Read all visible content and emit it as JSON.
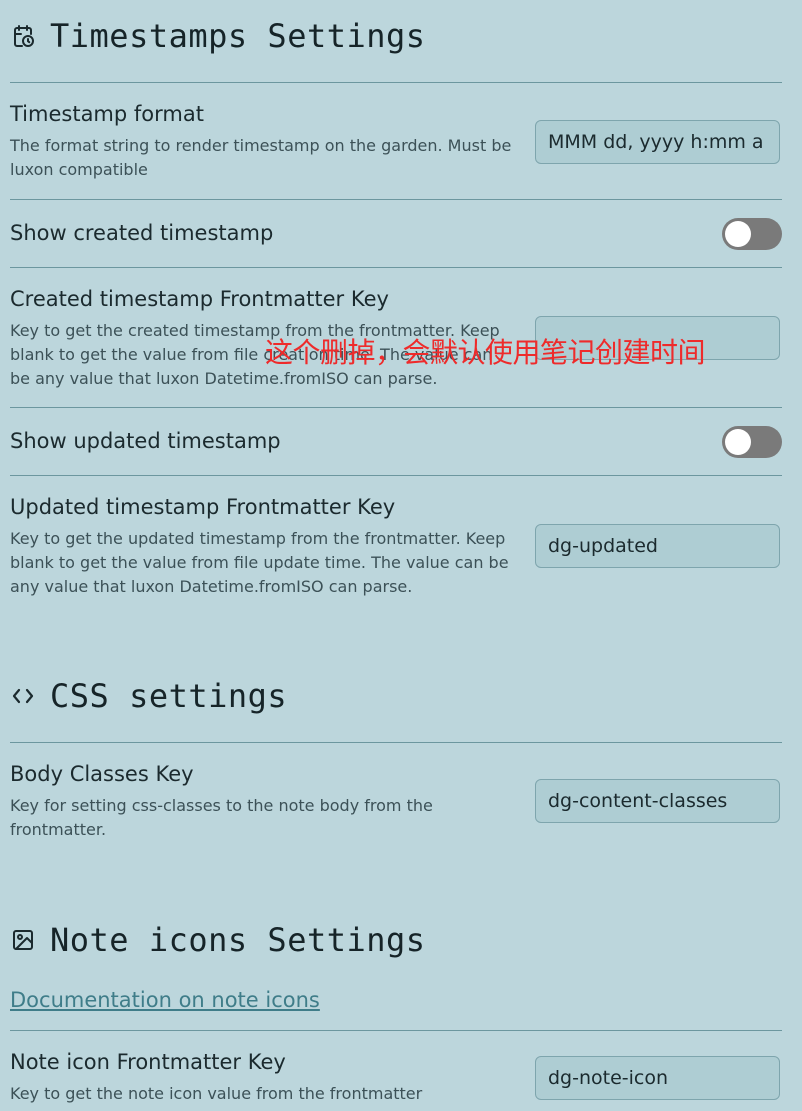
{
  "timestamps": {
    "title": "Timestamps Settings",
    "icon": "calendar-clock-icon",
    "timestamp_format": {
      "title": "Timestamp format",
      "desc": "The format string to render timestamp on the garden. Must be luxon compatible",
      "value": "MMM dd, yyyy h:mm a"
    },
    "show_created": {
      "title": "Show created timestamp",
      "enabled": false
    },
    "created_key": {
      "title": "Created timestamp Frontmatter Key",
      "desc": "Key to get the created timestamp from the frontmatter. Keep blank to get the value from file creation time. The value can be any value that luxon Datetime.fromISO can parse.",
      "value": ""
    },
    "show_updated": {
      "title": "Show updated timestamp",
      "enabled": false
    },
    "updated_key": {
      "title": "Updated timestamp Frontmatter Key",
      "desc": "Key to get the updated timestamp from the frontmatter. Keep blank to get the value from file update time. The value can be any value that luxon Datetime.fromISO can parse.",
      "value": "dg-updated"
    }
  },
  "css": {
    "title": "CSS settings",
    "icon": "code-icon",
    "body_classes": {
      "title": "Body Classes Key",
      "desc": "Key for setting css-classes to the note body from the frontmatter.",
      "value": "dg-content-classes"
    }
  },
  "note_icons": {
    "title": "Note icons Settings",
    "icon": "image-icon",
    "doc_link": "Documentation on note icons",
    "icon_key": {
      "title": "Note icon Frontmatter Key",
      "desc": "Key to get the note icon value from the frontmatter",
      "value": "dg-note-icon"
    }
  },
  "annotation": "这个删掉，会默认使用笔记创建时间",
  "colors": {
    "background": "#bcd6dc",
    "input_background": "#aecdd3",
    "toggle_off": "#7a7a7a",
    "link": "#3f7d89",
    "annotation": "#ee2b2b"
  }
}
